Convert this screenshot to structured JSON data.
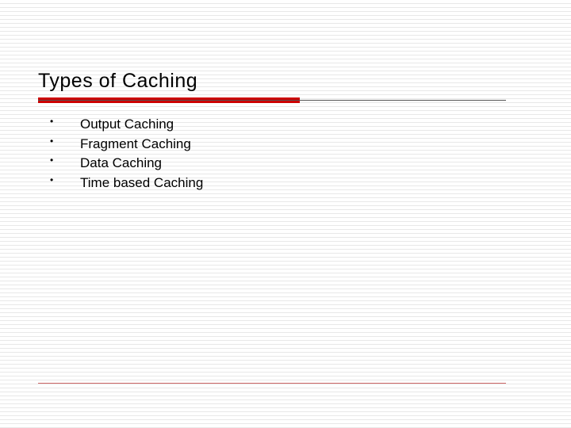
{
  "slide": {
    "title": "Types of Caching",
    "bullets": [
      "Output Caching",
      "Fragment Caching",
      "Data Caching",
      "Time based Caching"
    ]
  },
  "colors": {
    "accent": "#cc0000",
    "bottom_rule": "#cc6666"
  }
}
